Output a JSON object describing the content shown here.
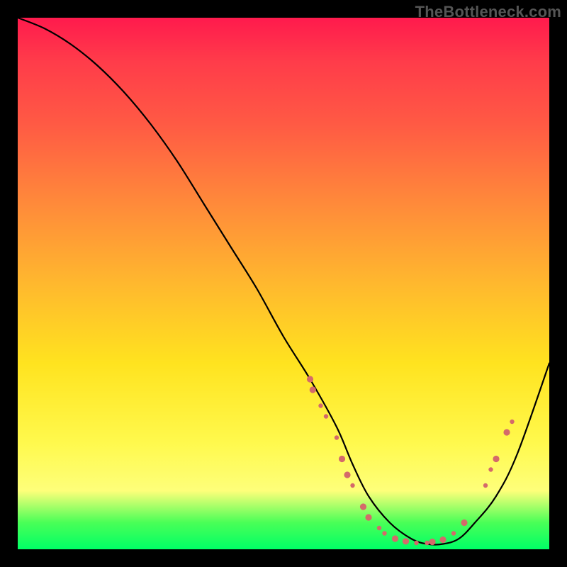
{
  "watermark": "TheBottleneck.com",
  "chart_data": {
    "type": "line",
    "title": "",
    "xlabel": "",
    "ylabel": "",
    "xlim": [
      0,
      100
    ],
    "ylim": [
      0,
      100
    ],
    "grid": false,
    "legend": false,
    "background_gradient": {
      "orientation": "vertical",
      "stops": [
        {
          "pos": 0,
          "color": "#ff1a4d"
        },
        {
          "pos": 20,
          "color": "#ff5a44"
        },
        {
          "pos": 50,
          "color": "#ffb82e"
        },
        {
          "pos": 80,
          "color": "#fff94d"
        },
        {
          "pos": 95,
          "color": "#49ff57"
        },
        {
          "pos": 100,
          "color": "#00ff66"
        }
      ]
    },
    "series": [
      {
        "name": "bottleneck-curve",
        "color": "#000000",
        "x": [
          0,
          5,
          10,
          15,
          20,
          25,
          30,
          35,
          40,
          45,
          50,
          55,
          60,
          63,
          66,
          70,
          74,
          77,
          80,
          83,
          86,
          90,
          94,
          100
        ],
        "values": [
          100,
          98,
          95,
          91,
          86,
          80,
          73,
          65,
          57,
          49,
          40,
          32,
          23,
          16,
          10,
          5,
          2,
          1,
          1,
          2,
          5,
          10,
          18,
          35
        ]
      }
    ],
    "highlight_points": {
      "color": "#d46a6a",
      "radius_small": 3.2,
      "radius_large": 4.6,
      "points": [
        {
          "x": 55,
          "y": 32,
          "r": "large"
        },
        {
          "x": 55.5,
          "y": 30,
          "r": "large"
        },
        {
          "x": 57,
          "y": 27,
          "r": "small"
        },
        {
          "x": 58,
          "y": 25,
          "r": "small"
        },
        {
          "x": 60,
          "y": 21,
          "r": "small"
        },
        {
          "x": 61,
          "y": 17,
          "r": "large"
        },
        {
          "x": 62,
          "y": 14,
          "r": "large"
        },
        {
          "x": 63,
          "y": 12,
          "r": "small"
        },
        {
          "x": 65,
          "y": 8,
          "r": "large"
        },
        {
          "x": 66,
          "y": 6,
          "r": "large"
        },
        {
          "x": 68,
          "y": 4,
          "r": "small"
        },
        {
          "x": 69,
          "y": 3,
          "r": "small"
        },
        {
          "x": 71,
          "y": 2,
          "r": "large"
        },
        {
          "x": 73,
          "y": 1.5,
          "r": "large"
        },
        {
          "x": 75,
          "y": 1.2,
          "r": "small"
        },
        {
          "x": 77,
          "y": 1.2,
          "r": "small"
        },
        {
          "x": 78,
          "y": 1.4,
          "r": "large"
        },
        {
          "x": 80,
          "y": 1.8,
          "r": "large"
        },
        {
          "x": 82,
          "y": 3,
          "r": "small"
        },
        {
          "x": 84,
          "y": 5,
          "r": "large"
        },
        {
          "x": 88,
          "y": 12,
          "r": "small"
        },
        {
          "x": 89,
          "y": 15,
          "r": "small"
        },
        {
          "x": 90,
          "y": 17,
          "r": "large"
        },
        {
          "x": 92,
          "y": 22,
          "r": "large"
        },
        {
          "x": 93,
          "y": 24,
          "r": "small"
        }
      ]
    }
  }
}
